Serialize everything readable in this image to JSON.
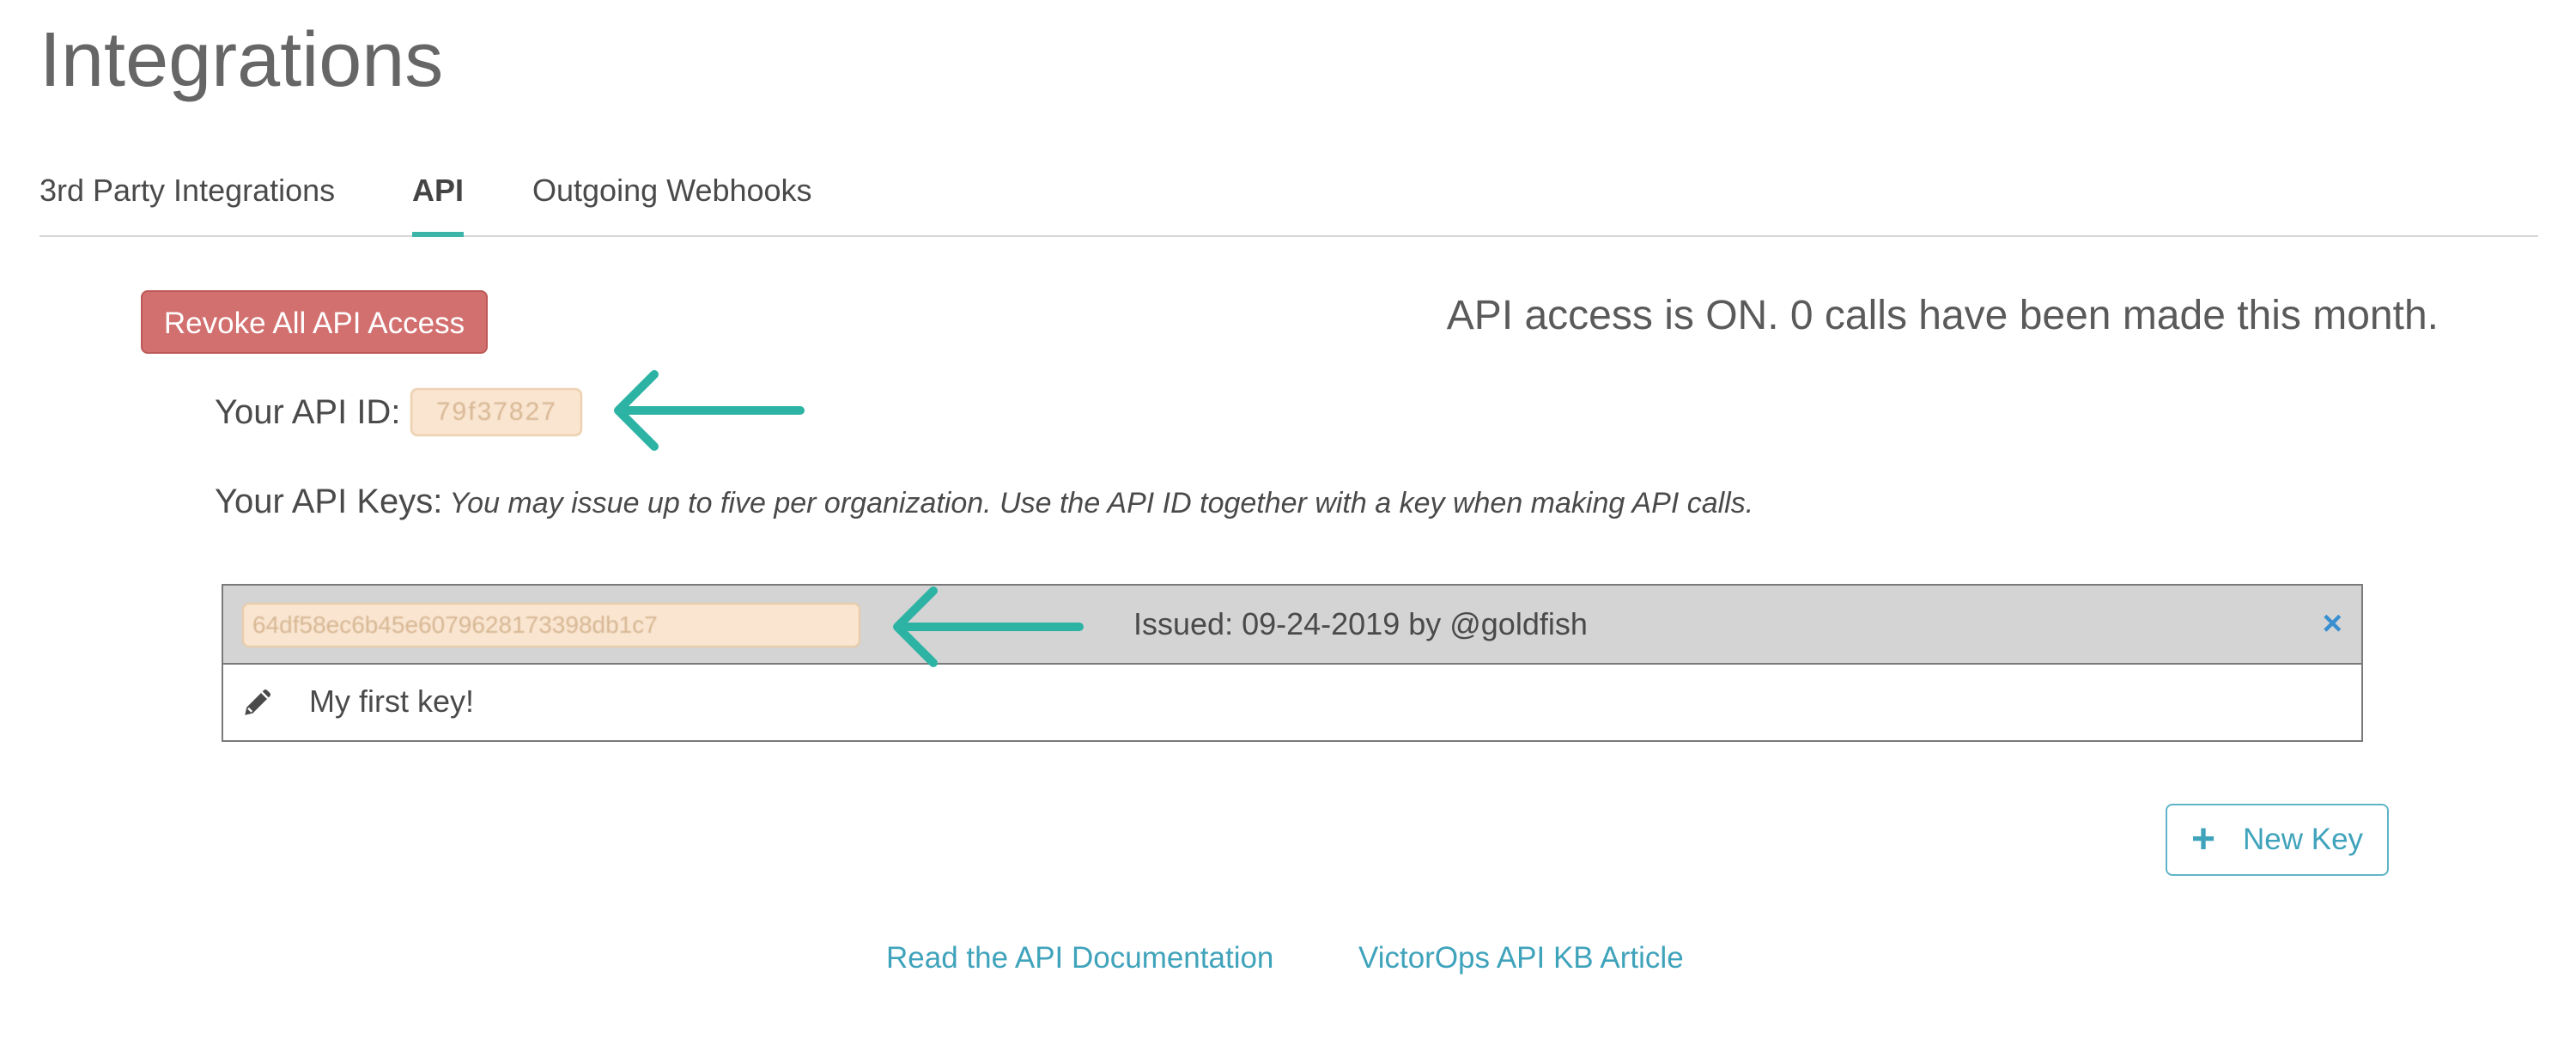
{
  "page": {
    "title": "Integrations"
  },
  "tabs": [
    {
      "label": "3rd Party Integrations",
      "active": false
    },
    {
      "label": "API",
      "active": true
    },
    {
      "label": "Outgoing Webhooks",
      "active": false
    }
  ],
  "api": {
    "revoke_label": "Revoke All API Access",
    "status_text": "API access is ON. 0 calls have been made this month.",
    "api_id_label": "Your API ID:",
    "api_id_value": "79f37827",
    "api_keys_label": "Your API Keys:",
    "api_keys_hint": "You may issue up to five per organization. Use the API ID together with a key when making API calls."
  },
  "keys": [
    {
      "value": "64df58ec6b45e6079628173398db1c7",
      "issued": "Issued: 09-24-2019 by @goldfish",
      "delete_symbol": "×",
      "name": "My first key!"
    }
  ],
  "actions": {
    "new_key_symbol": "+",
    "new_key_label": "New Key"
  },
  "links": {
    "docs": "Read the API Documentation",
    "kb": "VictorOps API KB Article"
  },
  "icons": {
    "arrow": "arrow-left-icon",
    "pencil": "pencil-icon",
    "close": "close-icon",
    "plus": "plus-icon"
  },
  "colors": {
    "accent_teal": "#3bb5a8",
    "danger": "#d2706f",
    "link": "#3fa3bb",
    "delete": "#3a8fd0",
    "redacted_bg": "#f9e5d0"
  }
}
